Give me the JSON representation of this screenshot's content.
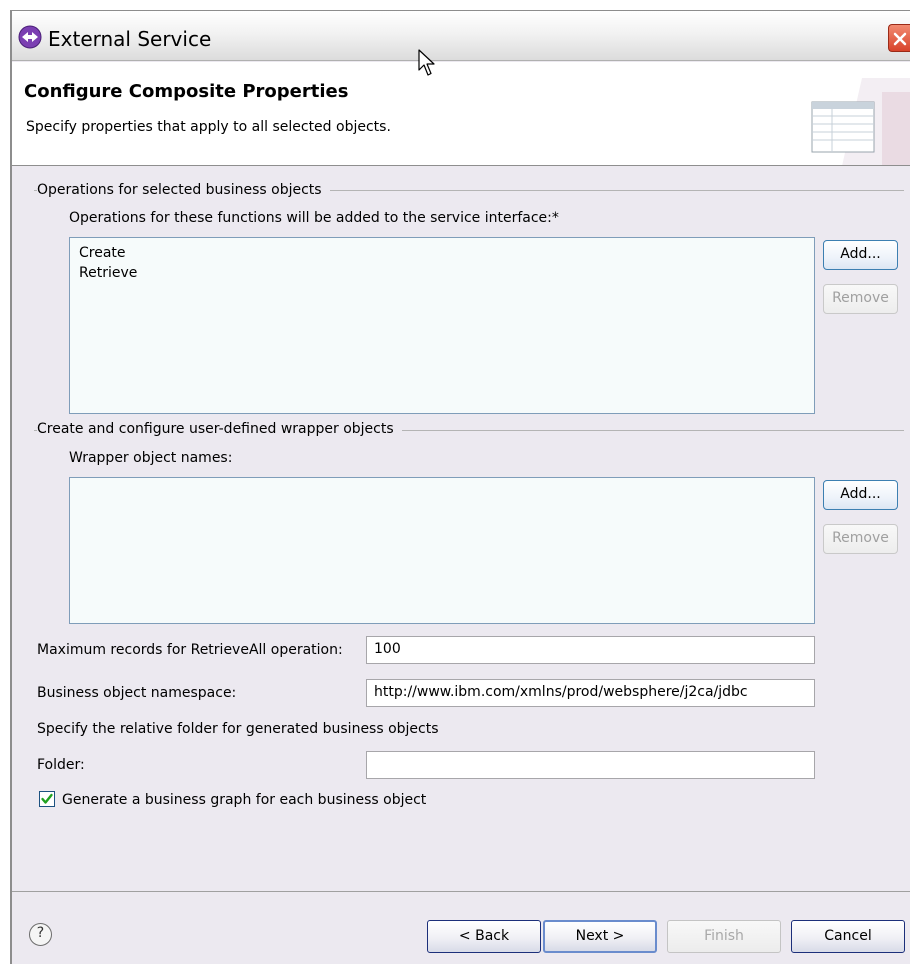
{
  "window": {
    "title": "External Service"
  },
  "header": {
    "title": "Configure Composite Properties",
    "subtitle": "Specify properties that apply to all selected objects."
  },
  "operations_group": {
    "label": "Operations for selected business objects",
    "sublabel": "Operations for these functions will be added to the service interface:*",
    "items": [
      "Create",
      "Retrieve"
    ],
    "add_label": "Add...",
    "remove_label": "Remove"
  },
  "wrapper_group": {
    "label": "Create and configure user-defined wrapper objects",
    "sublabel": "Wrapper object names:",
    "add_label": "Add...",
    "remove_label": "Remove"
  },
  "fields": {
    "max_records_label": "Maximum records for RetrieveAll operation:",
    "max_records_value": "100",
    "namespace_label": "Business object namespace:",
    "namespace_value": "http://www.ibm.com/xmlns/prod/websphere/j2ca/jdbc",
    "folder_hint": "Specify the relative folder for generated business objects",
    "folder_label": "Folder:",
    "folder_value": ""
  },
  "business_graph": {
    "label": "Generate a business graph for each business object",
    "checked": true
  },
  "footer": {
    "help_glyph": "?",
    "back_label": "< Back",
    "next_label": "Next >",
    "finish_label": "Finish",
    "cancel_label": "Cancel"
  },
  "icons": {
    "app": "external-service-icon",
    "close": "close-icon",
    "header_graphic": "table-properties-icon",
    "help": "help-icon",
    "cursor": "mouse-pointer-icon"
  },
  "colors": {
    "window_bg": "#ece9f0",
    "list_bg": "#f6fbfb",
    "close_red": "#d8432b",
    "button_border": "#3c7fb1"
  }
}
